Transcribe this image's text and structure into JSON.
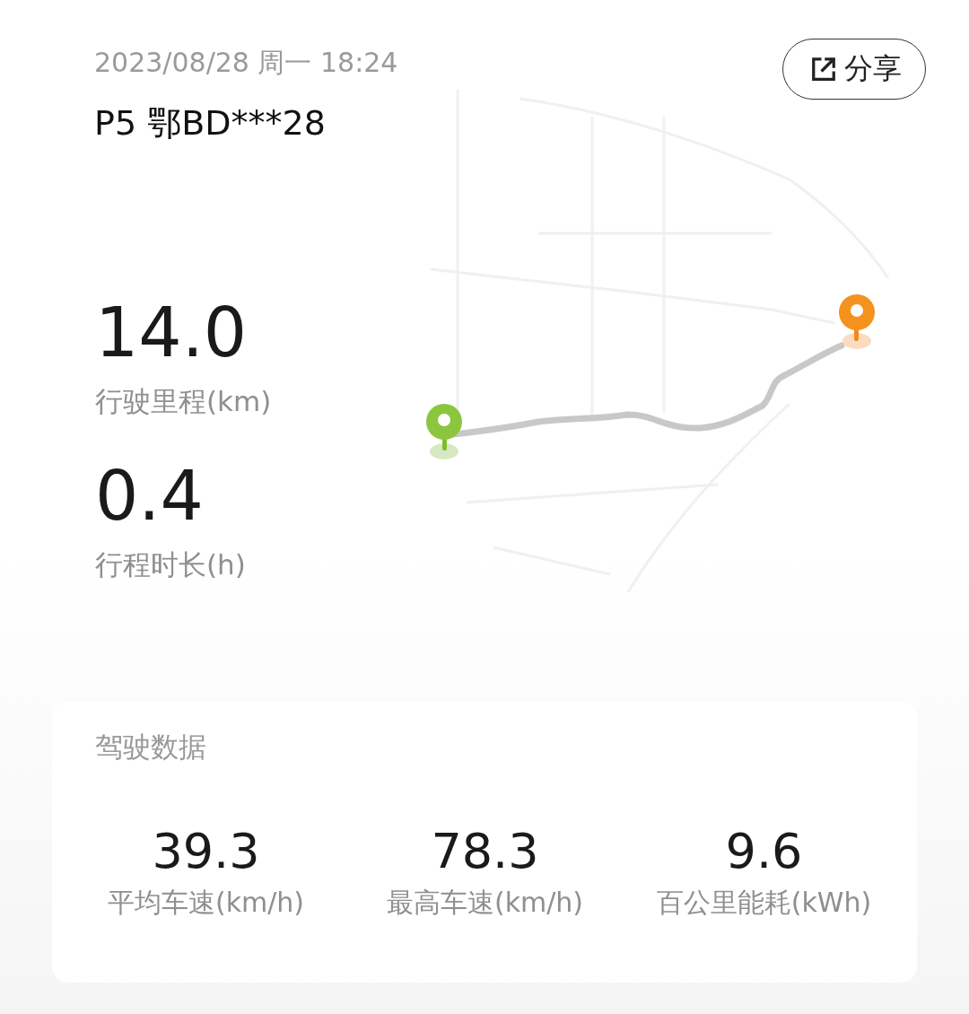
{
  "header": {
    "datetime": "2023/08/28 周一 18:24",
    "vehicle": "P5 鄂BD***28",
    "share_button": {
      "label": "分享"
    }
  },
  "trip_stats": [
    {
      "value": "14.0",
      "label": "行驶里程(km)"
    },
    {
      "value": "0.4",
      "label": "行程时长(h)"
    }
  ],
  "driving_data": {
    "title": "驾驶数据",
    "metrics": [
      {
        "value": "39.3",
        "label": "平均车速(km/h)"
      },
      {
        "value": "78.3",
        "label": "最高车速(km/h)"
      },
      {
        "value": "9.6",
        "label": "百公里能耗(kWh)"
      }
    ]
  }
}
